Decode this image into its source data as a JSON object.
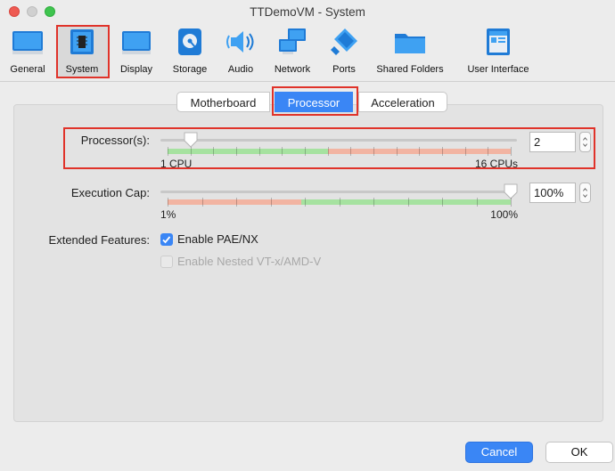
{
  "window": {
    "title": "TTDemoVM - System"
  },
  "toolbar": {
    "items": [
      {
        "label": "General",
        "icon": "general-icon"
      },
      {
        "label": "System",
        "icon": "system-icon"
      },
      {
        "label": "Display",
        "icon": "display-icon"
      },
      {
        "label": "Storage",
        "icon": "storage-icon"
      },
      {
        "label": "Audio",
        "icon": "audio-icon"
      },
      {
        "label": "Network",
        "icon": "network-icon"
      },
      {
        "label": "Ports",
        "icon": "ports-icon"
      },
      {
        "label": "Shared Folders",
        "icon": "shared-folders-icon"
      },
      {
        "label": "User Interface",
        "icon": "user-interface-icon"
      }
    ],
    "selected": "System"
  },
  "tabs": {
    "motherboard": "Motherboard",
    "processor": "Processor",
    "acceleration": "Acceleration",
    "active": "Processor"
  },
  "processor": {
    "label": "Processor(s):",
    "value": "2",
    "min_label": "1 CPU",
    "max_label": "16 CPUs",
    "min": 1,
    "max": 16,
    "current": 2
  },
  "execution_cap": {
    "label": "Execution Cap:",
    "value": "100%",
    "min_label": "1%",
    "max_label": "100%",
    "min": 1,
    "max": 100,
    "current": 100
  },
  "extended_features": {
    "label": "Extended Features:",
    "pae_nx": {
      "label": "Enable PAE/NX",
      "checked": true,
      "enabled": true
    },
    "nested_vt": {
      "label": "Enable Nested VT-x/AMD-V",
      "checked": false,
      "enabled": false
    }
  },
  "buttons": {
    "cancel": "Cancel",
    "ok": "OK"
  },
  "colors": {
    "accent": "#3a86f5",
    "highlight": "#e0332a",
    "range_good": "#a6e2a0",
    "range_warn": "#f2b4a2"
  }
}
